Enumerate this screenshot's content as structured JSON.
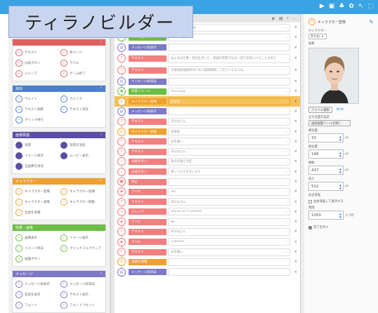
{
  "title": "ティラノビルダー",
  "toolbar": {
    "icons": [
      "play-icon",
      "save-icon",
      "share-icon",
      "gear-icon",
      "back-icon",
      "expand-icon"
    ]
  },
  "mid_header": {
    "icons": [
      "run-icon",
      "copy-icon",
      "search-icon",
      "collapse-icon"
    ]
  },
  "palette": {
    "sections": [
      {
        "title": "",
        "color": "#e06060",
        "style": "pal-red",
        "items": [
          "テキスト",
          "改ページ",
          "分岐ボタン",
          "ラベル",
          "ジャンプ",
          "ゲーム終了"
        ]
      },
      {
        "title": "演出",
        "color": "#4a7fd0",
        "style": "pal-blue",
        "items": [
          "ウェイト",
          "クェイク",
          "テキスト装飾",
          "テキスト消去",
          "クリック待ち"
        ]
      },
      {
        "title": "画像関連",
        "color": "#5a4fa3",
        "style": "pal-purple",
        "items": [
          "背景",
          "背景を消去",
          "イメージ表示",
          "ムービー表示",
          "全画像を消去"
        ]
      },
      {
        "title": "キャラクター",
        "color": "#f0a030",
        "style": "pal-orange",
        "items": [
          "キャラクター登場",
          "キャラクター退場",
          "キャラクター表情",
          "キャラクター移動",
          "全員を退場"
        ]
      },
      {
        "title": "効果・画像",
        "color": "#6cbd45",
        "style": "pal-green",
        "items": [
          "画像表示",
          "イメージ表示",
          "イメージ消去",
          "クリックフェクティブ",
          "画面ボタン"
        ]
      },
      {
        "title": "メッセージ",
        "color": "#7d79c6",
        "style": "pal-violet",
        "items": [
          "メッセージ枠表示",
          "メッセージ枠消去",
          "名前を表示",
          "テキスト表示",
          "フォント",
          "フォントリセット"
        ]
      }
    ]
  },
  "rows": [
    {
      "label": "背景イメージ",
      "color": "#6cbd45",
      "icon": "image",
      "value": "初期ただ感じ.png",
      "chev": true
    },
    {
      "label": "BGM再生",
      "color": "#6cbd45",
      "icon": "music",
      "value": "music.ogg",
      "chev": true
    },
    {
      "label": "メッセージ枠表示",
      "color": "#7d79c6",
      "icon": "msg",
      "value": "",
      "chev": false
    },
    {
      "label": "テキスト",
      "color": "#f08080",
      "icon": "text",
      "value": "みんなは仕事、普段生活した。意図の状態でほぼ一部で状況にけることは考え一人でいました。",
      "chev": false,
      "tall": true
    },
    {
      "label": "テキスト",
      "color": "#f08080",
      "icon": "text",
      "value": "大変相談相談時のために面倒期間して見ているような。",
      "chev": false,
      "tall": true
    },
    {
      "label": "メッセージ枠消去",
      "color": "#7d79c6",
      "icon": "msg",
      "value": "",
      "chev": false
    },
    {
      "label": "背景イメージ",
      "color": "#6cbd45",
      "icon": "image",
      "value": "PR33.png",
      "chev": true
    },
    {
      "label": "キャラクター登場",
      "color": "#f0a030",
      "icon": "chara",
      "value": "あかね",
      "chev": true,
      "highlight": true
    },
    {
      "label": "メッセージ枠表示",
      "color": "#7d79c6",
      "icon": "msg",
      "value": "",
      "chev": false
    },
    {
      "label": "テキスト",
      "color": "#f08080",
      "icon": "text",
      "value": "あかねさん",
      "chev": true
    },
    {
      "label": "キャラクター退場",
      "color": "#f0a030",
      "icon": "chara",
      "value": "初期値",
      "chev": true
    },
    {
      "label": "テキスト",
      "color": "#f08080",
      "icon": "text",
      "value": "お見違い",
      "chev": true
    },
    {
      "label": "テキスト",
      "color": "#f08080",
      "icon": "text",
      "value": "あかねさん",
      "chev": true
    },
    {
      "label": "分岐ボタン",
      "color": "#f08080",
      "icon": "branch",
      "value": "私の作業を決定",
      "chev": true
    },
    {
      "label": "分岐ボタン",
      "color": "#f08080",
      "icon": "branch",
      "value": "用ってなきを戻します",
      "chev": true
    },
    {
      "label": "停止",
      "color": "#f08080",
      "icon": "stop",
      "value": "",
      "chev": false
    },
    {
      "label": "ラベル",
      "color": "#f08080",
      "icon": "label",
      "value": "Yes",
      "chev": true
    },
    {
      "label": "テキスト",
      "color": "#f08080",
      "icon": "text",
      "value": "あかねさん",
      "chev": true
    },
    {
      "label": "ジャンプ",
      "color": "#f08080",
      "icon": "jump",
      "value": "scene1.ks *Common",
      "chev": true
    },
    {
      "label": "ラベル",
      "color": "#f08080",
      "icon": "label",
      "value": "No",
      "chev": true
    },
    {
      "label": "テキスト",
      "color": "#f08080",
      "icon": "text",
      "value": "あかねさん",
      "chev": true
    },
    {
      "label": "ラベル",
      "color": "#f08080",
      "icon": "label",
      "value": "Common",
      "chev": true
    },
    {
      "label": "テキスト",
      "color": "#f08080",
      "icon": "text",
      "value": "お見違い",
      "chev": true
    },
    {
      "label": "全員を退場",
      "color": "#f0a030",
      "icon": "chara",
      "value": "",
      "chev": false
    },
    {
      "label": "メッセージ枠消去",
      "color": "#7d79c6",
      "icon": "msg",
      "value": "",
      "chev": false
    }
  ],
  "properties": {
    "header": "キャラクター登場",
    "chara_label": "キャラクター",
    "chara_value": "あかね",
    "image_label": "画像",
    "file_button": "ファイル選択",
    "new_link": "NEW",
    "setting_label": "立ち位置の設定",
    "setting_button": "画面配置ツールを開く",
    "fields": [
      {
        "label": "横位置",
        "value": "33",
        "unit": "px"
      },
      {
        "label": "縦位置",
        "value": "148",
        "unit": "px"
      },
      {
        "label": "横幅",
        "value": "437",
        "unit": "px"
      },
      {
        "label": "高さ",
        "value": "522",
        "unit": "px"
      }
    ],
    "reverse_label": "左右反転",
    "reverse_check": "左右反転して表示する",
    "time_label": "時間",
    "time_value": "1000",
    "time_unit": "ミリ秒",
    "wait_check": "完了を待つ"
  }
}
